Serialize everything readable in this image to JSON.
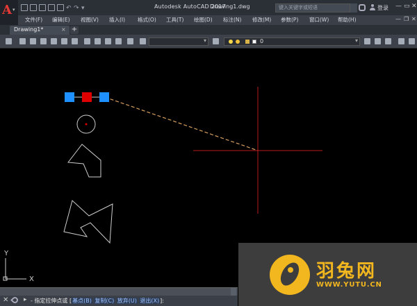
{
  "app": {
    "title": "Autodesk AutoCAD 2017",
    "file": "Drawing1.dwg",
    "app_letter": "A"
  },
  "search": {
    "placeholder": "键入关键字或短语"
  },
  "user": {
    "login": "登录"
  },
  "menu": [
    "文件(F)",
    "编辑(E)",
    "视图(V)",
    "插入(I)",
    "格式(O)",
    "工具(T)",
    "绘图(D)",
    "标注(N)",
    "修改(M)",
    "参数(P)",
    "窗口(W)",
    "帮助(H)"
  ],
  "tabs": {
    "active": "Drawing1*",
    "close": "×",
    "add": "+"
  },
  "toolbar": {
    "layer_value": "0"
  },
  "ucs": {
    "x_label": "X",
    "y_label": "Y"
  },
  "command": {
    "prompt": "- 指定拉伸点或",
    "options": [
      "基点(B)",
      "复制(C)",
      "放弃(U)",
      "退出(X)"
    ],
    "suffix": "]:"
  },
  "watermark": {
    "brand": "羽兔网",
    "url": "WWW.YUTU.CN"
  },
  "colors": {
    "grip_blue": "#1e90ff",
    "grip_red": "#e00000",
    "crosshair": "#b71c1c",
    "rubberband": "#d8a060",
    "brand": "#f2b61f"
  }
}
